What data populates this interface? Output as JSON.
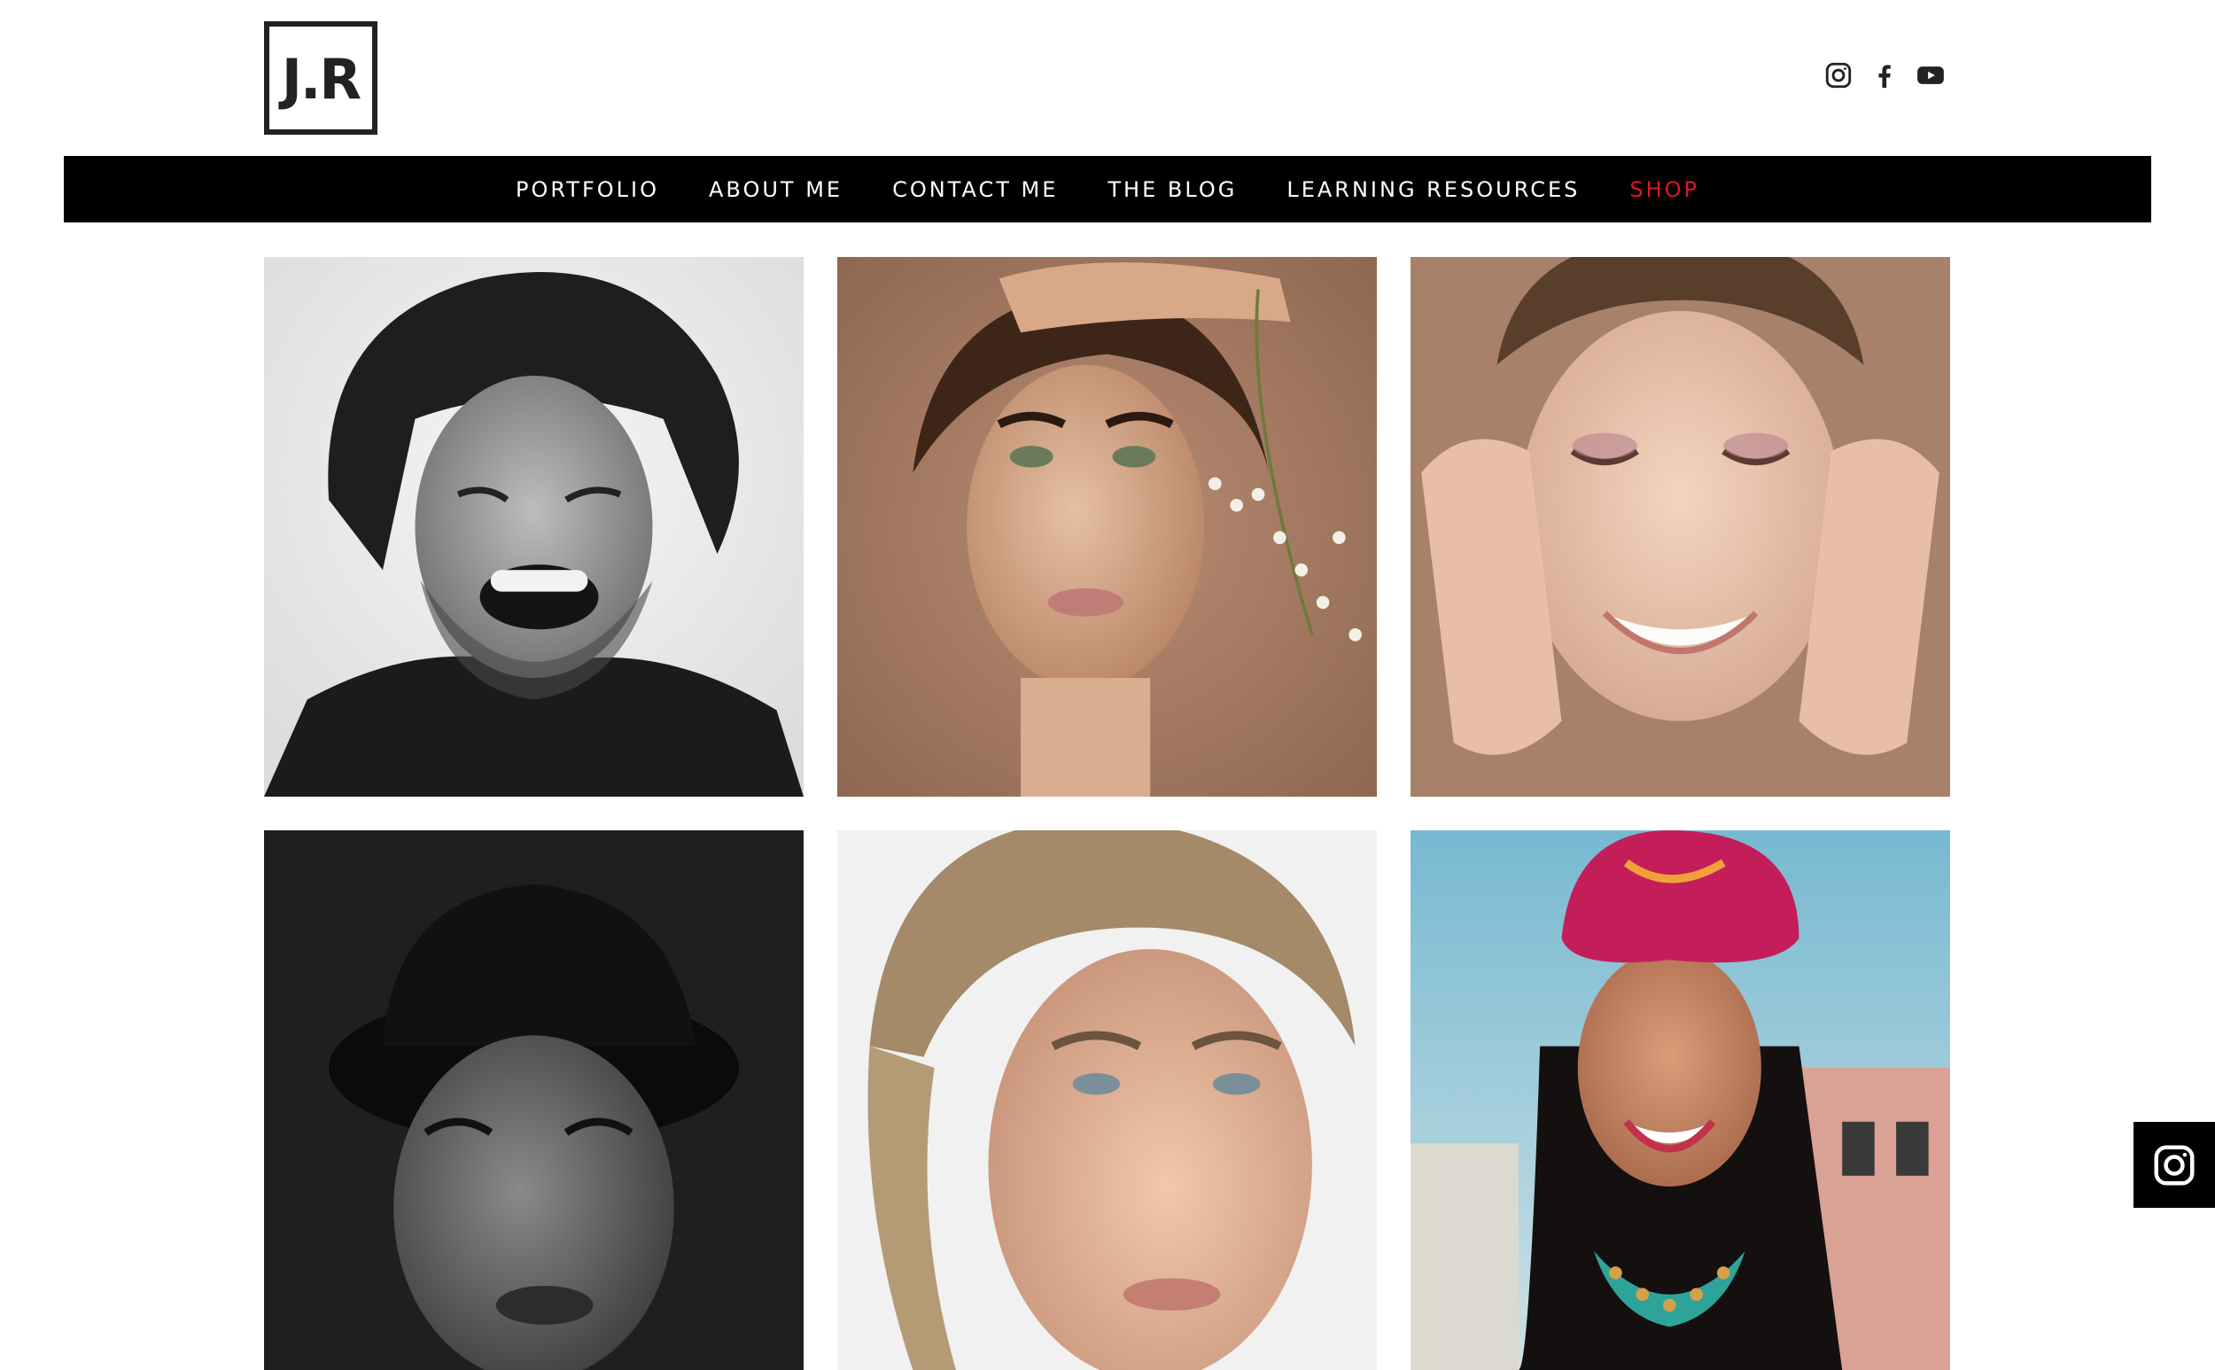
{
  "brand": {
    "logo_text": "J.R"
  },
  "social": [
    {
      "name": "instagram-icon"
    },
    {
      "name": "facebook-icon"
    },
    {
      "name": "youtube-icon"
    }
  ],
  "nav": {
    "items": [
      {
        "label": "PORTFOLIO"
      },
      {
        "label": "ABOUT ME"
      },
      {
        "label": "CONTACT ME"
      },
      {
        "label": "THE BLOG"
      },
      {
        "label": "LEARNING RESOURCES"
      },
      {
        "label": "SHOP",
        "color": "#e0142b"
      }
    ]
  },
  "gallery": {
    "photos": [
      {
        "name": "portrait-laughing-man-bw"
      },
      {
        "name": "portrait-woman-flowers"
      },
      {
        "name": "portrait-woman-hands-face"
      },
      {
        "name": "portrait-man-hat-bw"
      },
      {
        "name": "portrait-blonde-woman"
      },
      {
        "name": "portrait-woman-headscarf"
      }
    ]
  },
  "floating": {
    "icon": "instagram-icon"
  },
  "colors": {
    "nav_background": "#000000",
    "nav_text": "#ffffff",
    "accent": "#e0142b",
    "logo": "#222222"
  }
}
